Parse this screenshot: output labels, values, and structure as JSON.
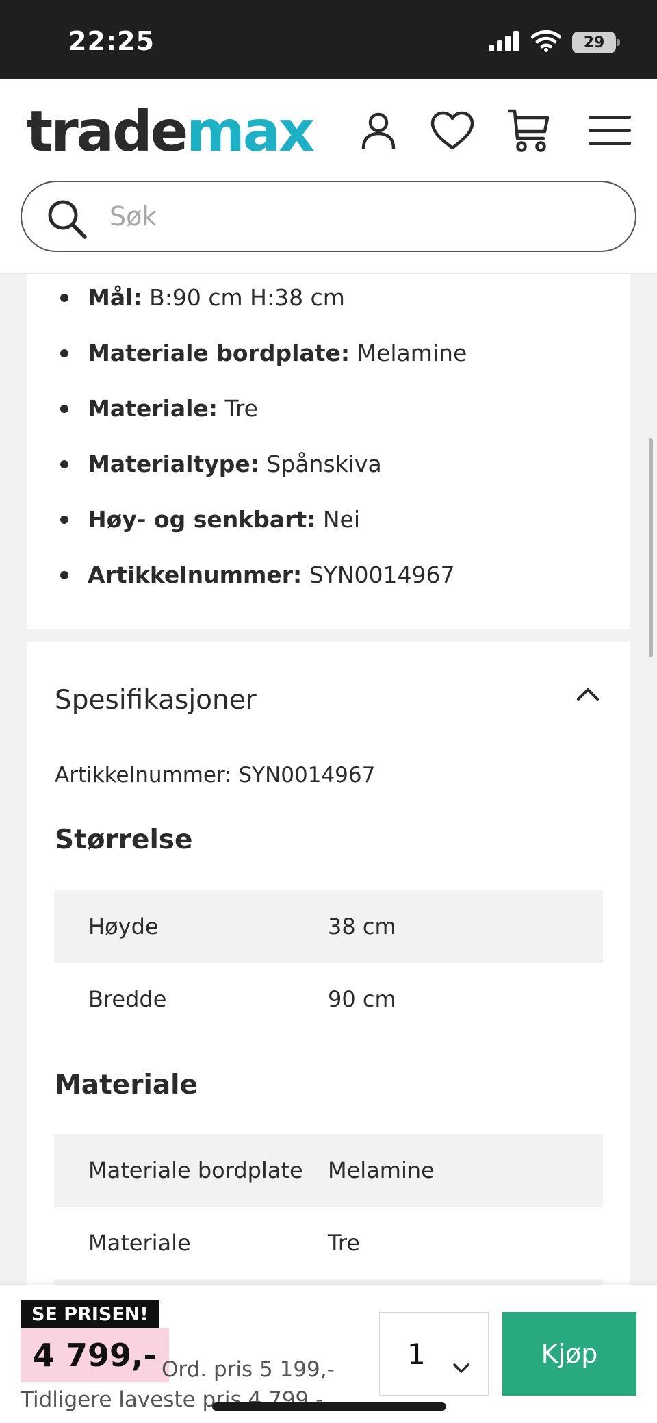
{
  "status_bar": {
    "time": "22:25",
    "battery": "29"
  },
  "header": {
    "logo_part1": "trade",
    "logo_part2": "max",
    "search_placeholder": "Søk",
    "icons": [
      "account-icon",
      "heart-icon",
      "cart-icon",
      "menu-icon"
    ]
  },
  "product_info": {
    "items": [
      {
        "label": "Mål:",
        "value": "B:90 cm H:38 cm"
      },
      {
        "label": "Materiale bordplate:",
        "value": "Melamine"
      },
      {
        "label": "Materiale:",
        "value": "Tre"
      },
      {
        "label": "Materialtype:",
        "value": "Spånskiva"
      },
      {
        "label": "Høy- og senkbart:",
        "value": "Nei"
      },
      {
        "label": "Artikkelnummer:",
        "value": "SYN0014967"
      }
    ]
  },
  "specifications": {
    "title": "Spesifikasjoner",
    "article_label": "Artikkelnummer:",
    "article_value": "SYN0014967",
    "sections": [
      {
        "heading": "Størrelse",
        "rows": [
          {
            "key": "Høyde",
            "value": "38 cm"
          },
          {
            "key": "Bredde",
            "value": "90 cm"
          }
        ]
      },
      {
        "heading": "Materiale",
        "rows": [
          {
            "key": "Materiale bordplate",
            "value": "Melamine"
          },
          {
            "key": "Materiale",
            "value": "Tre"
          }
        ]
      }
    ]
  },
  "purchase_bar": {
    "badge": "SE PRISEN!",
    "price": "4 799,-",
    "ordinary_price": "Ord. pris 5 199,-",
    "lowest_price": "Tidligere laveste pris 4 799,-",
    "quantity": "1",
    "buy_label": "Kjøp"
  },
  "colors": {
    "brand_dark": "#2b2b2b",
    "brand_accent": "#1eb0c4",
    "buy_button": "#28a97f",
    "price_highlight": "#f9d3e0"
  }
}
